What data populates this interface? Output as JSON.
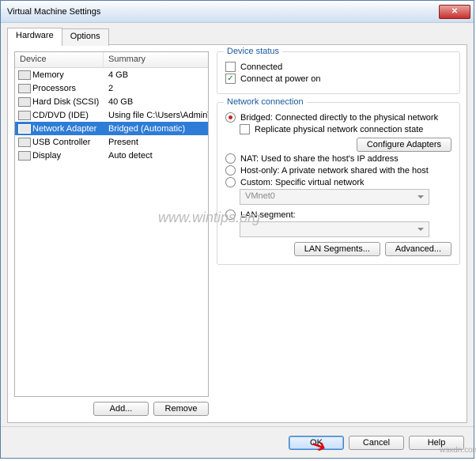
{
  "window": {
    "title": "Virtual Machine Settings"
  },
  "tabs": {
    "hardware": "Hardware",
    "options": "Options"
  },
  "device_table": {
    "col_device": "Device",
    "col_summary": "Summary",
    "rows": [
      {
        "name": "Memory",
        "summary": "4 GB"
      },
      {
        "name": "Processors",
        "summary": "2"
      },
      {
        "name": "Hard Disk (SCSI)",
        "summary": "40 GB"
      },
      {
        "name": "CD/DVD (IDE)",
        "summary": "Using file C:\\Users\\Admin\\Do..."
      },
      {
        "name": "Network Adapter",
        "summary": "Bridged (Automatic)"
      },
      {
        "name": "USB Controller",
        "summary": "Present"
      },
      {
        "name": "Display",
        "summary": "Auto detect"
      }
    ]
  },
  "left_buttons": {
    "add": "Add...",
    "remove": "Remove"
  },
  "device_status": {
    "legend": "Device status",
    "connected": "Connected",
    "connect_power": "Connect at power on"
  },
  "net": {
    "legend": "Network connection",
    "bridged": "Bridged: Connected directly to the physical network",
    "replicate": "Replicate physical network connection state",
    "configure": "Configure Adapters",
    "nat": "NAT: Used to share the host's IP address",
    "hostonly": "Host-only: A private network shared with the host",
    "custom": "Custom: Specific virtual network",
    "custom_value": "VMnet0",
    "lan": "LAN segment:",
    "lan_value": "",
    "lan_segments": "LAN Segments...",
    "advanced": "Advanced..."
  },
  "bottom": {
    "ok": "OK",
    "cancel": "Cancel",
    "help": "Help"
  },
  "watermark": "www.wintips.org",
  "wsx": "wsxdn.com"
}
